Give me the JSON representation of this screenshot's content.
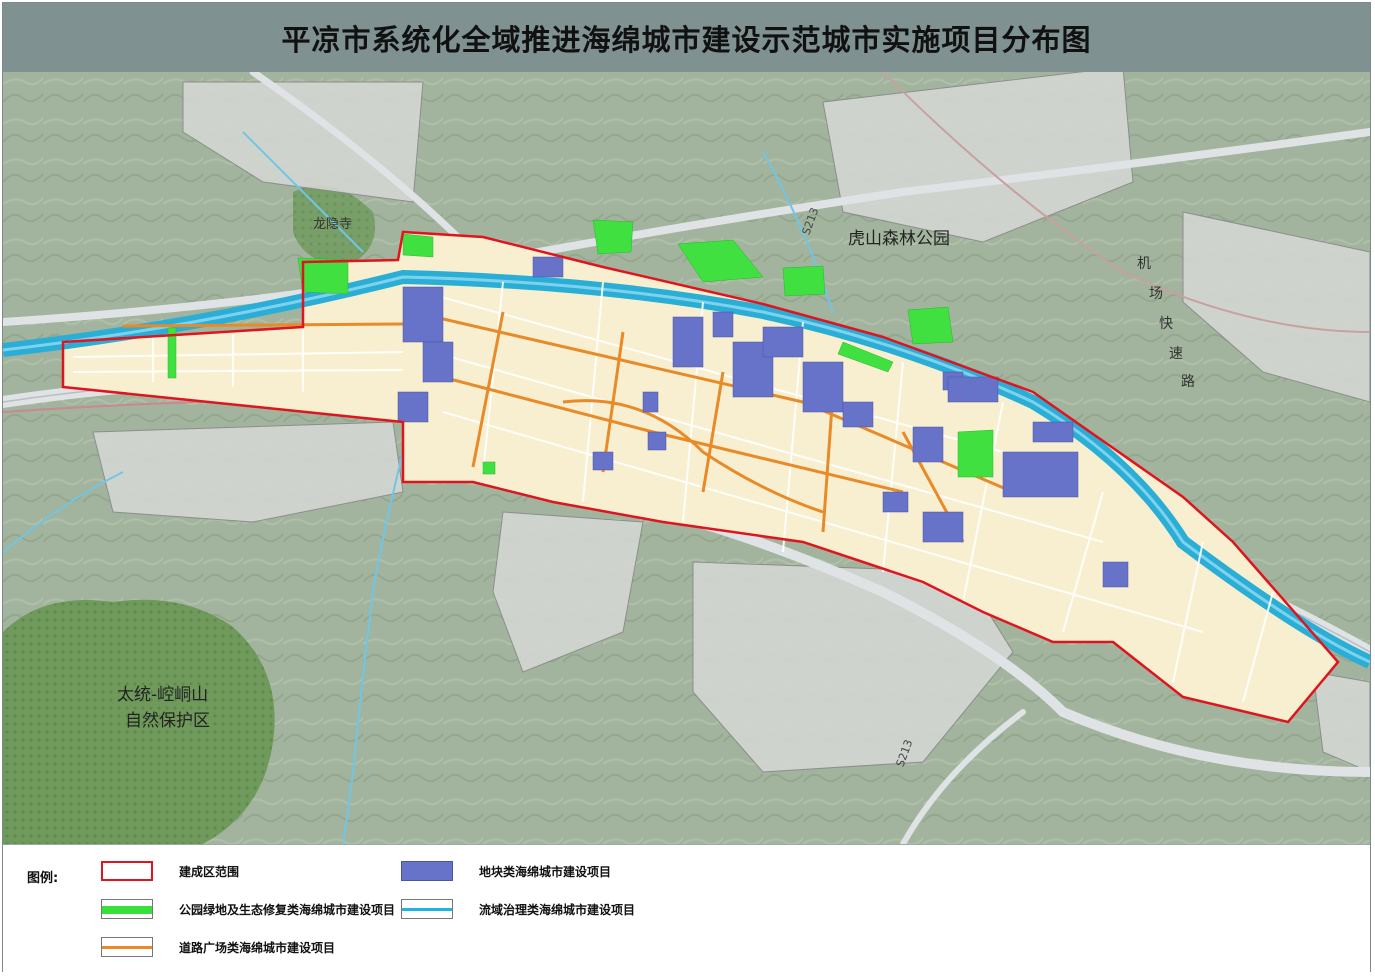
{
  "title": "平凉市系统化全域推进海绵城市建设示范城市实施项目分布图",
  "map": {
    "labels": {
      "temple": "龙隐寺",
      "park": "虎山森林公园",
      "road_s213": "S213",
      "airport_road": [
        "机",
        "场",
        "快",
        "速",
        "路"
      ],
      "reserve_line1": "太统-崆峒山",
      "reserve_line2": "自然保护区"
    }
  },
  "legend": {
    "title": "图例:",
    "items": [
      {
        "label": "建成区范围",
        "swatch": "outline",
        "color": "#e0141e"
      },
      {
        "label": "地块类海绵城市建设项目",
        "swatch": "fill",
        "color": "#6673c8"
      },
      {
        "label": "公园绿地及生态修复类海绵城市建设项目",
        "swatch": "band",
        "color": "#38e03a"
      },
      {
        "label": "流域治理类海绵城市建设项目",
        "swatch": "band",
        "color": "#1fb3e6"
      },
      {
        "label": "道路广场类海绵城市建设项目",
        "swatch": "band",
        "color": "#e98a28"
      }
    ]
  },
  "colors": {
    "terrain": "#9fb29a",
    "urban": "#f7efcf",
    "river": "#2aaed6",
    "boundary": "#e0141e",
    "project_block": "#6673c8",
    "green_project": "#3fe040",
    "road_project": "#e98a28"
  }
}
